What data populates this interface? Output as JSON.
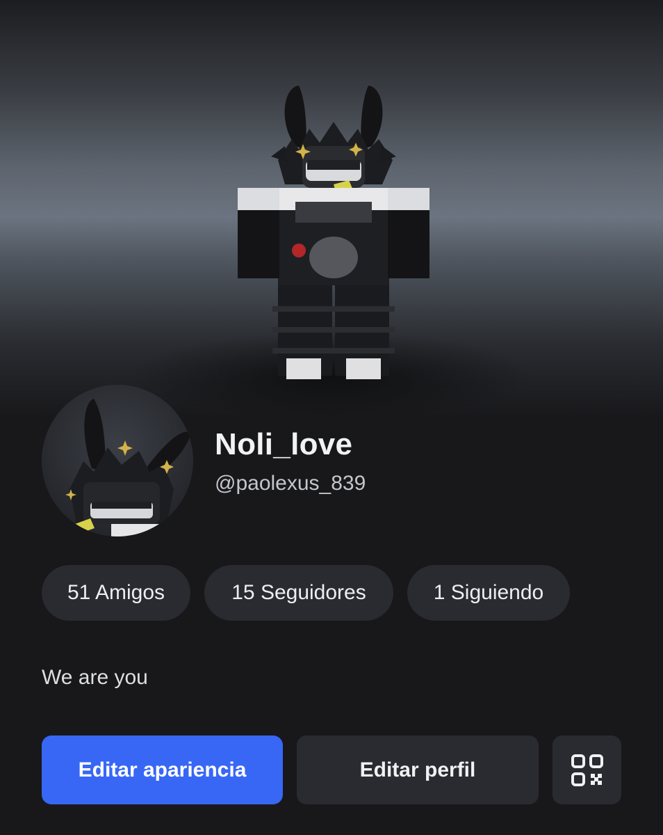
{
  "profile": {
    "display_name": "Noli_love",
    "username": "@paolexus_839",
    "bio": "We are you"
  },
  "stats": {
    "friends": "51 Amigos",
    "followers": "15 Seguidores",
    "following": "1 Siguiendo"
  },
  "actions": {
    "edit_appearance": "Editar apariencia",
    "edit_profile": "Editar perfil",
    "qr_icon": "qr-code-icon"
  },
  "colors": {
    "background": "#18181b",
    "primary_button": "#3867f5",
    "secondary_button": "#2a2b30"
  }
}
